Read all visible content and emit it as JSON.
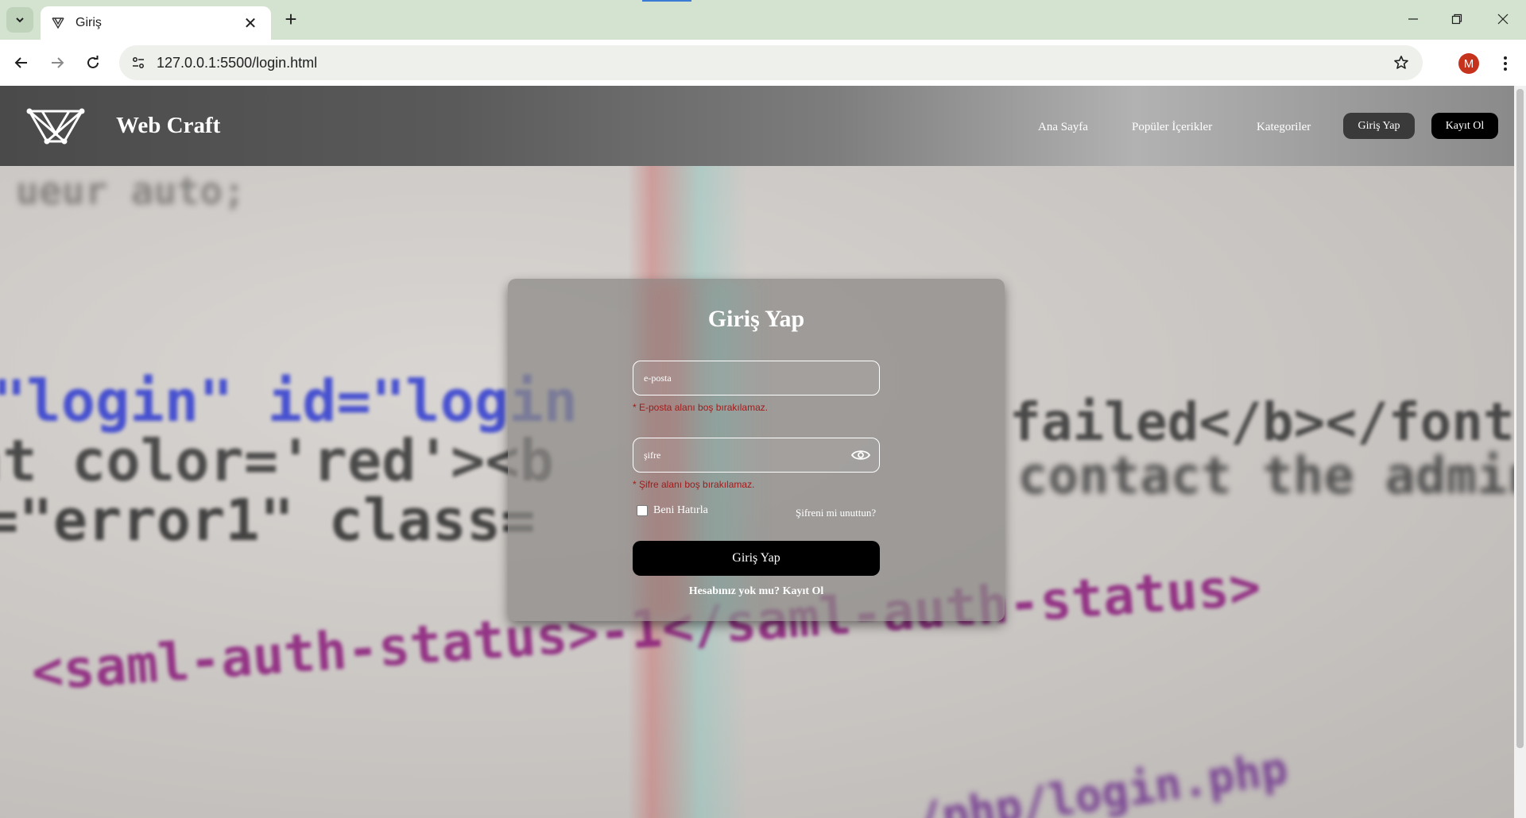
{
  "browser": {
    "tab_title": "Giriş",
    "url": "127.0.0.1:5500/login.html",
    "profile_initial": "M"
  },
  "site": {
    "brand": "Web Craft",
    "nav": {
      "home": "Ana Sayfa",
      "popular": "Popüler İçerikler",
      "categories": "Kategoriler",
      "login": "Giriş Yap",
      "register": "Kayıt Ol"
    }
  },
  "background_code": {
    "line1": "\"login\" id=\"login",
    "line2": "nt color='red'><b",
    "line3": "=\"error1\" class=",
    "line4": "<saml-auth-status>-1</saml-auth-status>",
    "line5": "failed</b></font></",
    "line6": "contact the administ",
    "line7": "ueur auto;",
    "line8": "/php/login.php"
  },
  "login": {
    "title": "Giriş Yap",
    "email_placeholder": "e-posta",
    "email_error": "* E-posta alanı boş bırakılamaz.",
    "password_placeholder": "şifre",
    "password_error": "* Şifre alanı boş bırakılamaz.",
    "remember_label": "Beni Hatırla",
    "forgot_label": "Şifreni mi unuttun?",
    "submit_label": "Giriş Yap",
    "signup_prompt": "Hesabınız yok mu?",
    "signup_link": "Kayıt Ol"
  },
  "colors": {
    "error": "#a21a1a",
    "button_bg": "#000000",
    "avatar_bg": "#c5331d"
  },
  "icons": [
    "chevron-down-icon",
    "webcraft-favicon-icon",
    "close-icon",
    "plus-icon",
    "minimize-icon",
    "restore-icon",
    "back-icon",
    "forward-icon",
    "reload-icon",
    "site-info-icon",
    "star-icon",
    "kebab-menu-icon",
    "webcraft-logo-icon",
    "eye-icon"
  ]
}
